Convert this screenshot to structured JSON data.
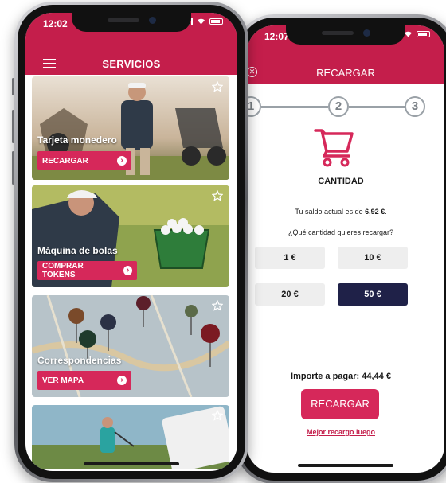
{
  "recargar_screen": {
    "status_time": "12:07",
    "title": "RECARGAR",
    "steps": [
      "1",
      "2",
      "3"
    ],
    "section_title": "CANTIDAD",
    "balance_text": "Tu saldo actual es de",
    "balance_value": "6,92 €",
    "balance_suffix": ".",
    "question": "¿Qué cantidad quieres recargar?",
    "amounts": [
      {
        "label": "1 €",
        "selected": false
      },
      {
        "label": "10 €",
        "selected": false
      },
      {
        "label": "20 €",
        "selected": false
      },
      {
        "label": "50 €",
        "selected": true
      }
    ],
    "total": "Importe a pagar: 44,44 €",
    "submit_label": "RECARGAR",
    "later_link": "Mejor recargo luego"
  },
  "servicios_screen": {
    "status_time": "12:02",
    "title": "SERVICIOS",
    "cards": [
      {
        "title": "Tarjeta monedero",
        "button": "RECARGAR",
        "icon": "golf-cart-photo"
      },
      {
        "title": "Máquina de bolas",
        "button": "COMPRAR TOKENS",
        "icon": "golf-balls-photo"
      },
      {
        "title": "Correspondencias",
        "button": "VER MAPA",
        "icon": "map-pins-photo"
      },
      {
        "title": "",
        "button": "",
        "icon": "golfer-swing-photo"
      }
    ]
  },
  "colors": {
    "brand": "#c41e4b",
    "button": "#d6285a",
    "selected_amount": "#1f2148"
  }
}
